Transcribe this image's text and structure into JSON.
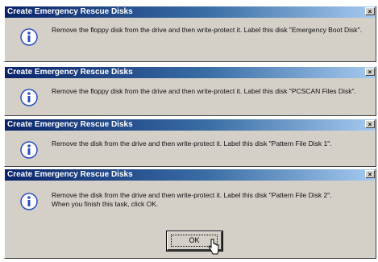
{
  "dialogs": [
    {
      "title": "Create Emergency Rescue Disks",
      "icon": "info-icon",
      "message": "Remove the floppy disk from the drive and then write-protect it. Label this disk \"Emergency Boot Disk\".",
      "message2": ""
    },
    {
      "title": "Create Emergency Rescue Disks",
      "icon": "info-icon",
      "message": "Remove the floppy disk from the drive and then write-protect it. Label this disk \"PCSCAN Files Disk\".",
      "message2": ""
    },
    {
      "title": "Create Emergency Rescue Disks",
      "icon": "info-icon",
      "message": "Remove the disk from the drive and then write-protect it. Label this disk \"Pattern File Disk 1\".",
      "message2": ""
    },
    {
      "title": "Create Emergency Rescue Disks",
      "icon": "info-icon",
      "message": "Remove the disk from the drive and then write-protect it. Label this disk \"Pattern File Disk 2\".",
      "message2": "When you finish this task, click OK."
    }
  ],
  "ok_button": {
    "label": "OK"
  },
  "close_glyph": "×"
}
